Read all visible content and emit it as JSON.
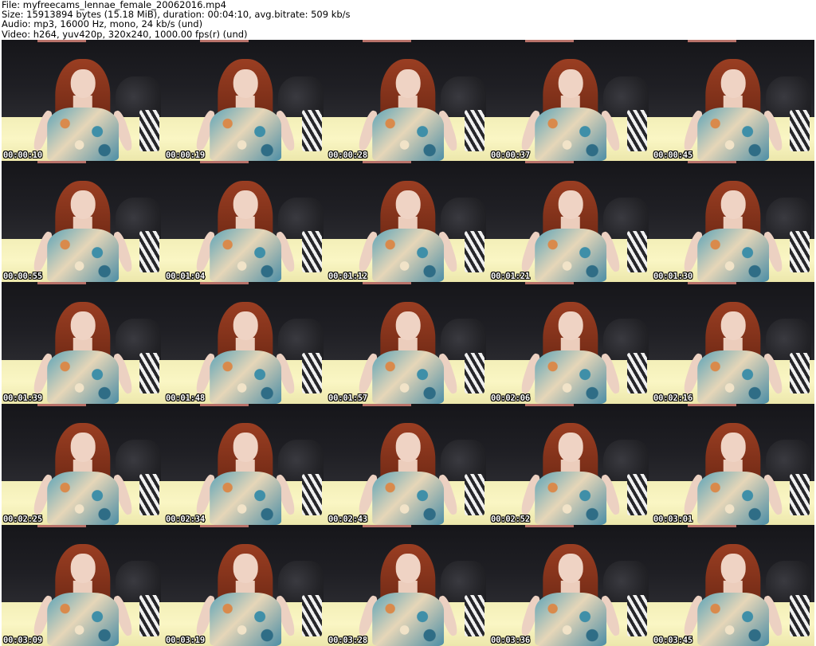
{
  "header": {
    "file_line": "File: myfreecams_lennae_female_20062016.mp4",
    "size_line": "Size: 15913894 bytes (15.18 MiB), duration: 00:04:10, avg.bitrate: 509 kb/s",
    "audio_line": "Audio: mp3, 16000 Hz, mono, 24 kb/s (und)",
    "video_line": "Video: h264, yuv420p, 320x240, 1000.00 fps(r) (und)"
  },
  "thumbnails": [
    {
      "timestamp": "00:00:10"
    },
    {
      "timestamp": "00:00:19"
    },
    {
      "timestamp": "00:00:28"
    },
    {
      "timestamp": "00:00:37"
    },
    {
      "timestamp": "00:00:45"
    },
    {
      "timestamp": "00:00:55"
    },
    {
      "timestamp": "00:01:04"
    },
    {
      "timestamp": "00:01:12"
    },
    {
      "timestamp": "00:01:21"
    },
    {
      "timestamp": "00:01:30"
    },
    {
      "timestamp": "00:01:39"
    },
    {
      "timestamp": "00:01:48"
    },
    {
      "timestamp": "00:01:57"
    },
    {
      "timestamp": "00:02:06"
    },
    {
      "timestamp": "00:02:16"
    },
    {
      "timestamp": "00:02:25"
    },
    {
      "timestamp": "00:02:34"
    },
    {
      "timestamp": "00:02:43"
    },
    {
      "timestamp": "00:02:52"
    },
    {
      "timestamp": "00:03:01"
    },
    {
      "timestamp": "00:03:09"
    },
    {
      "timestamp": "00:03:19"
    },
    {
      "timestamp": "00:03:28"
    },
    {
      "timestamp": "00:03:36"
    },
    {
      "timestamp": "00:03:45"
    }
  ]
}
